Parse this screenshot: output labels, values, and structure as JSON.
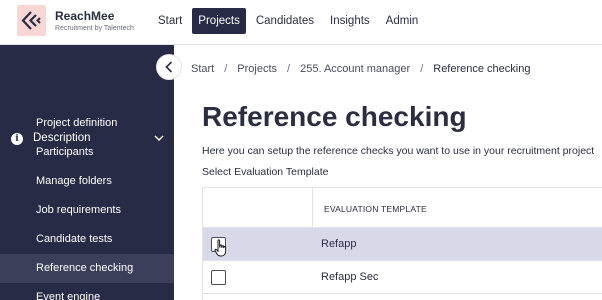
{
  "header": {
    "brand_name": "ReachMee",
    "brand_sub": "Recruitment by Talentech",
    "nav": [
      {
        "label": "Start",
        "active": false
      },
      {
        "label": "Projects",
        "active": true
      },
      {
        "label": "Candidates",
        "active": false
      },
      {
        "label": "Insights",
        "active": false
      },
      {
        "label": "Admin",
        "active": false
      }
    ]
  },
  "sidebar": {
    "section_label": "Description",
    "items": [
      {
        "label": "Project definition",
        "active": false
      },
      {
        "label": "Participants",
        "active": false
      },
      {
        "label": "Manage folders",
        "active": false
      },
      {
        "label": "Job requirements",
        "active": false
      },
      {
        "label": "Candidate tests",
        "active": false
      },
      {
        "label": "Reference checking",
        "active": true
      },
      {
        "label": "Event engine",
        "active": false
      }
    ]
  },
  "breadcrumb": [
    "Start",
    "Projects",
    "255. Account manager",
    "Reference checking"
  ],
  "main": {
    "title": "Reference checking",
    "description": "Here you can setup the reference checks you want to use in your recruitment project",
    "select_label": "Select Evaluation Template",
    "table_header": "EVALUATION TEMPLATE",
    "rows": [
      {
        "label": "Refapp",
        "checked": false
      },
      {
        "label": "Refapp Sec",
        "checked": false
      }
    ]
  },
  "colors": {
    "sidebar_bg": "#272b45",
    "nav_active_bg": "#272b45",
    "logo_bg": "#f6d7d4",
    "row_hover_bg": "#d8d9e8"
  }
}
